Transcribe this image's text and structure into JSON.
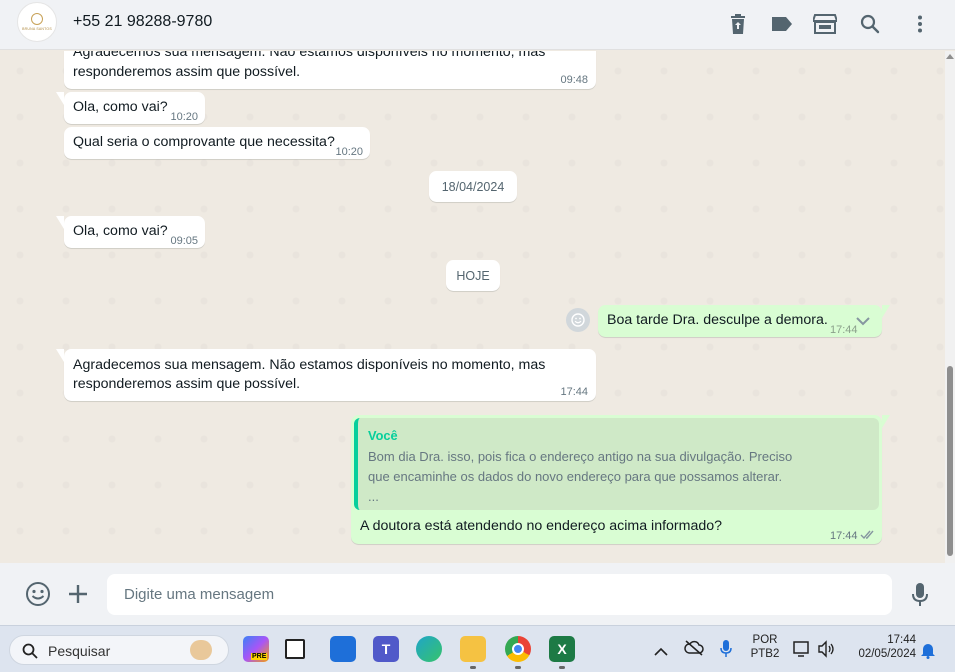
{
  "header": {
    "avatar_logo_text": "BRUNA SANTOS",
    "contact_name": "+55 21 98288-9780",
    "icons": [
      "trash-icon",
      "label-icon",
      "store-icon",
      "search-icon",
      "menu-icon"
    ]
  },
  "messages": [
    {
      "type": "in",
      "line1": "Agradecemos sua mensagem. Não estamos disponíveis no momento, mas",
      "line2": "responderemos assim que possível.",
      "time": "09:48"
    },
    {
      "type": "in",
      "text": "Ola, como vai?",
      "time": "10:20"
    },
    {
      "type": "in",
      "text": "Qual seria o comprovante que necessita?",
      "time": "10:20"
    },
    {
      "type": "date",
      "text": "18/04/2024"
    },
    {
      "type": "in",
      "text": "Ola, como vai?",
      "time": "09:05"
    },
    {
      "type": "date",
      "text": "HOJE"
    },
    {
      "type": "out",
      "text": "Boa tarde Dra. desculpe a demora.",
      "time": "17:44"
    },
    {
      "type": "in",
      "line1": "Agradecemos sua mensagem. Não estamos disponíveis no momento, mas",
      "line2": "responderemos assim que possível.",
      "time": "17:44"
    },
    {
      "type": "out",
      "quote_author": "Você",
      "quote_line1": "Bom dia Dra. isso, pois fica o endereço antigo na sua divulgação. Preciso",
      "quote_line2": "que encaminhe os dados do novo endereço para que possamos alterar.",
      "quote_line3": "...",
      "text": "A doutora está atendendo no endereço acima informado?",
      "time": "17:44"
    }
  ],
  "composer": {
    "placeholder": "Digite uma mensagem",
    "icons": [
      "emoji-icon",
      "plus-icon",
      "mic-icon"
    ]
  },
  "taskbar": {
    "search_label": "Pesquisar",
    "apps": [
      "copilot-app-icon",
      "task-view-icon",
      "store-app-icon",
      "teams-app-icon",
      "edge-app-icon",
      "file-explorer-icon",
      "chrome-app-icon",
      "excel-app-icon"
    ],
    "copilot_badge": "PRE",
    "lang_top": "POR",
    "lang_bottom": "PTB2",
    "time": "17:44",
    "date": "02/05/2024"
  },
  "colors": {
    "chat_bg": "#efeae2",
    "incoming_bubble": "#ffffff",
    "outgoing_bubble": "#d9fdd3",
    "quote_accent": "#06cf9c",
    "read_ticks": "#8696a0"
  }
}
